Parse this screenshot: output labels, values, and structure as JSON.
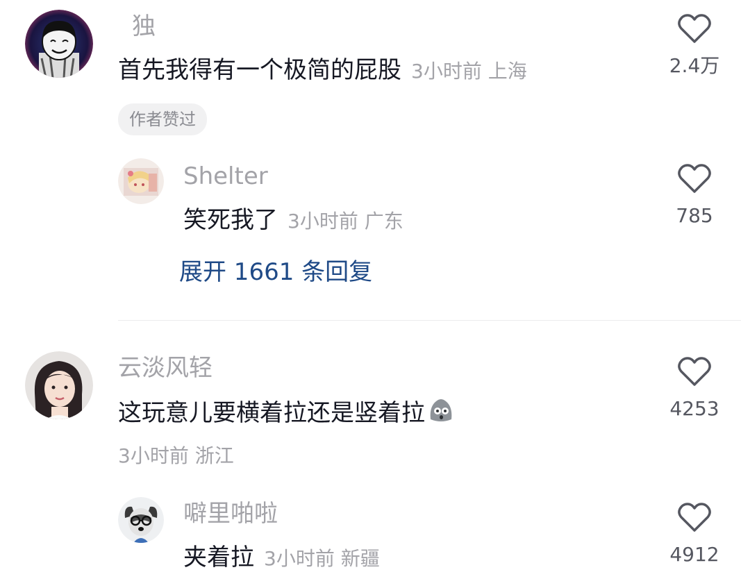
{
  "comments": [
    {
      "username": "独",
      "text": "首先我得有一个极简的屁股",
      "meta": "3小时前 上海",
      "likes": "2.4万",
      "badge": "作者赞过",
      "replies": [
        {
          "username": "Shelter",
          "text": "笑死我了",
          "meta": "3小时前 广东",
          "likes": "785"
        }
      ],
      "expand_label": "展开 1661 条回复"
    },
    {
      "username": "云淡风轻",
      "text": "这玩意儿要横着拉还是竖着拉",
      "meta": "3小时前 浙江",
      "likes": "4253",
      "replies": [
        {
          "username": "噼里啪啦",
          "text": "夹着拉",
          "meta": "3小时前 新疆",
          "likes": "4912"
        }
      ]
    }
  ],
  "icons": {
    "like": "heart-outline-icon",
    "emoji": "shocked-face-emoji"
  },
  "colors": {
    "username": "#a3a3a8",
    "text": "#161823",
    "link": "#1f4a87",
    "badge_bg": "#f1f1f2"
  }
}
